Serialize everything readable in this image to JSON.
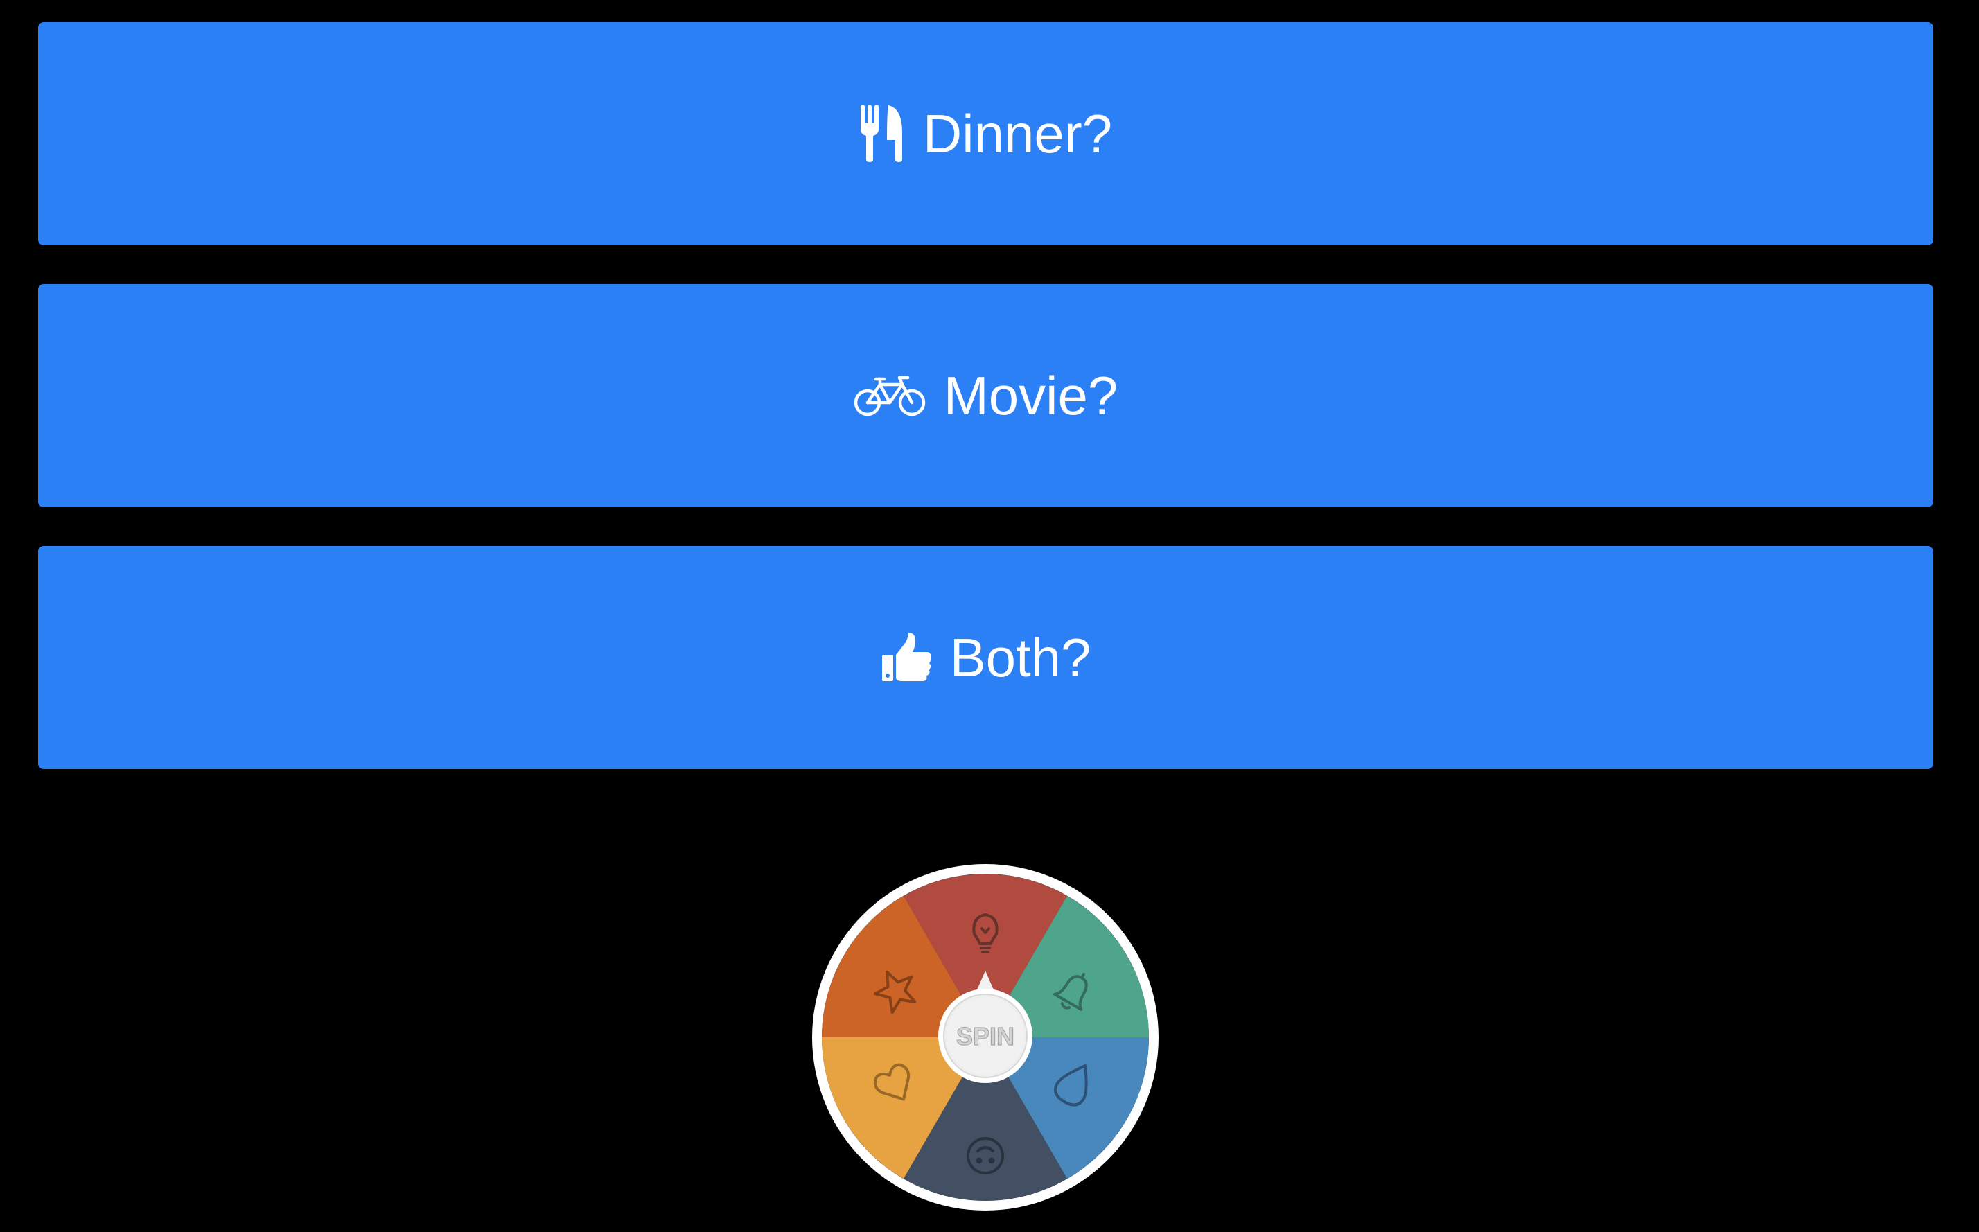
{
  "buttons": {
    "dinner": {
      "label": "Dinner?",
      "icon": "cutlery-icon"
    },
    "movie": {
      "label": "Movie?",
      "icon": "bicycle-icon"
    },
    "both": {
      "label": "Both?",
      "icon": "thumbs-up-icon"
    }
  },
  "wheel": {
    "spin_label": "SPIN",
    "segments": [
      {
        "icon": "lightbulb-icon",
        "color": "#b24b3f"
      },
      {
        "icon": "bell-icon",
        "color": "#4fa58c"
      },
      {
        "icon": "water-drop-icon",
        "color": "#4888bd"
      },
      {
        "icon": "smile-icon",
        "color": "#435063"
      },
      {
        "icon": "heart-icon",
        "color": "#e7a241"
      },
      {
        "icon": "star-icon",
        "color": "#cc6327"
      }
    ],
    "rim_color": "#ffffff"
  },
  "colors": {
    "background": "#000000",
    "button": "#2c80f5",
    "button_text": "#ffffff"
  }
}
